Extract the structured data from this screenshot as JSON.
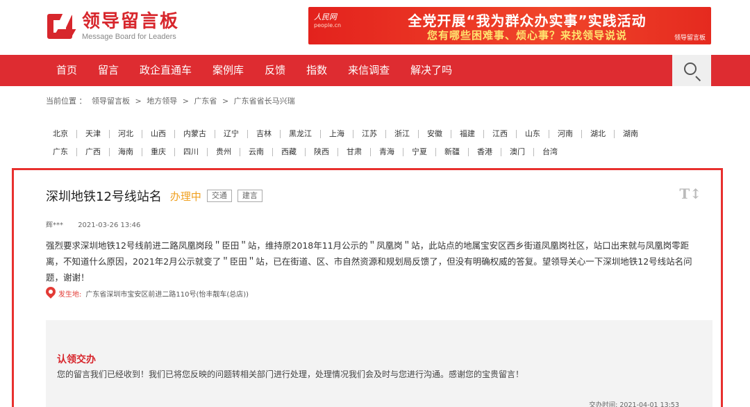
{
  "header": {
    "logo_cn": "领导留言板",
    "logo_en": "Message Board for Leaders",
    "banner": {
      "brand": "人民网",
      "brand_sub": "people.cn",
      "line1": "全党开展“我为群众办实事”实践活动",
      "line2": "您有哪些困难事、烦心事？来找领导说说",
      "corner": "领导留言板"
    }
  },
  "nav": {
    "items": [
      "首页",
      "留言",
      "政企直通车",
      "案例库",
      "反馈",
      "指数",
      "来信调查",
      "解决了吗"
    ],
    "search_icon": "search-icon"
  },
  "breadcrumb": {
    "label": "当前位置 ：",
    "items": [
      "领导留言板",
      ">",
      "地方领导",
      ">",
      "广东省",
      ">",
      "广东省省长马兴瑞"
    ]
  },
  "provinces": {
    "row1": [
      "北京",
      "天津",
      "河北",
      "山西",
      "内蒙古",
      "辽宁",
      "吉林",
      "黑龙江",
      "上海",
      "江苏",
      "浙江",
      "安徽",
      "福建",
      "江西",
      "山东",
      "河南",
      "湖北",
      "湖南"
    ],
    "row2": [
      "广东",
      "广西",
      "海南",
      "重庆",
      "四川",
      "贵州",
      "云南",
      "西藏",
      "陕西",
      "甘肃",
      "青海",
      "宁夏",
      "新疆",
      "香港",
      "澳门",
      "台湾"
    ]
  },
  "message": {
    "title": "深圳地铁12号线站名",
    "status": "办理中",
    "tags": [
      "交通",
      "建言"
    ],
    "font_tool": "T↕",
    "author": "辉***",
    "date": "2021-03-26 13:46",
    "content": "强烈要求深圳地铁12号线前进二路凤凰岗段＂臣田＂站，维持原2018年11月公示的＂凤凰岗＂站，此站点的地属宝安区西乡街道凤凰岗社区，站口出来就与凤凰岗零距离，不知道什么原因，2021年2月公示就变了＂臣田＂站，已在街道、区、市自然资源和规划局反馈了，但没有明确权威的答复。望领导关心一下深圳地铁12号线站名问题，谢谢！",
    "location_label": "发生地:",
    "location": "广东省深圳市宝安区前进二路110号(怡丰靓车(总店))"
  },
  "reply": {
    "title": "认领交办",
    "text": "您的留言我们已经收到！我们已将您反映的问题转相关部门进行处理，处理情况我们会及时与您进行沟通。感谢您的宝贵留言！",
    "time": "交办时间: 2021-04-01 13:53"
  },
  "colors": {
    "brand_red": "#d7262c",
    "nav_red": "#de2c31",
    "status_orange": "#f0a020",
    "box_border": "#e8302e"
  }
}
